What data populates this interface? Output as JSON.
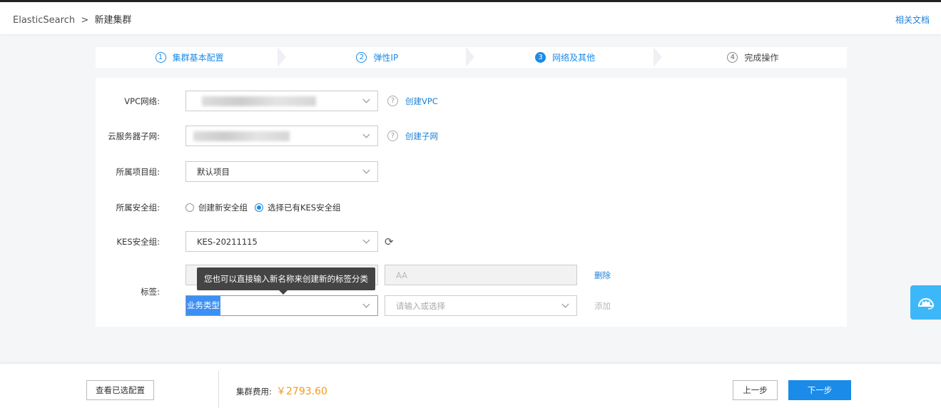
{
  "header": {
    "root": "ElasticSearch",
    "sep": ">",
    "current": "新建集群",
    "doc_link": "相关文档"
  },
  "steps": [
    {
      "n": "1",
      "label": "集群基本配置"
    },
    {
      "n": "2",
      "label": "弹性IP"
    },
    {
      "n": "3",
      "label": "网络及其他"
    },
    {
      "n": "4",
      "label": "完成操作"
    }
  ],
  "form": {
    "vpc": {
      "label": "VPC网络:",
      "link": "创建VPC",
      "help": "?"
    },
    "subnet": {
      "label": "云服务器子网:",
      "link": "创建子网",
      "help": "?"
    },
    "project": {
      "label": "所属项目组:",
      "value": "默认项目"
    },
    "secgroup": {
      "label": "所属安全组:",
      "options": [
        "创建新安全组",
        "选择已有KES安全组"
      ]
    },
    "kes": {
      "label": "KES安全组:",
      "value": "KES-20211115"
    },
    "tags": {
      "label": "标签:",
      "tooltip": "您也可以直接输入新名称来创建新的标签分类",
      "row1_value": "AA",
      "delete": "删除",
      "row2_key": "业务类型",
      "row2_placeholder": "请输入或选择",
      "add": "添加"
    }
  },
  "footer": {
    "view_config": "查看已选配置",
    "fee_label": "集群费用:",
    "fee": "￥2793.60",
    "prev": "上一步",
    "next": "下一步"
  }
}
